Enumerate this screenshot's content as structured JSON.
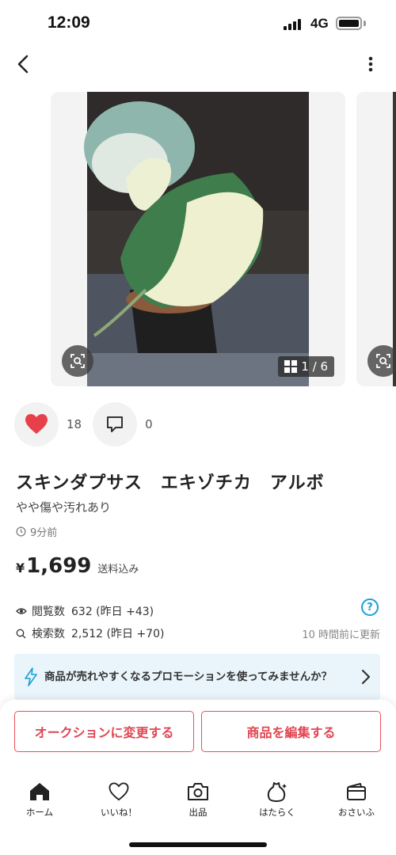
{
  "status_bar": {
    "time": "12:09",
    "network": "4G"
  },
  "carousel": {
    "counter": "1 / 6"
  },
  "engagement": {
    "likes": "18",
    "comments": "0"
  },
  "item": {
    "title": "スキンダプサス　エキゾチカ　アルボ",
    "condition": "やや傷や汚れあり",
    "posted": "9分前",
    "price_symbol": "¥",
    "price": "1,699",
    "shipping": "送料込み"
  },
  "stats": {
    "views_label": "閲覧数",
    "views_value": "632 (昨日 +43)",
    "search_label": "検索数",
    "search_value": "2,512 (昨日 +70)",
    "help": "?",
    "updated": "10 時間前に更新"
  },
  "promo": {
    "text": "商品が売れやすくなるプロモーションを使ってみませんか？"
  },
  "buttons": {
    "auction": "オークションに変更する",
    "edit": "商品を編集する"
  },
  "tabs": [
    {
      "label": "ホーム"
    },
    {
      "label": "いいね！"
    },
    {
      "label": "出品"
    },
    {
      "label": "はたらく"
    },
    {
      "label": "おさいふ"
    }
  ],
  "colors": {
    "accent_red": "#e8505b",
    "like_red": "#e8404a",
    "info_blue": "#1a9fd6"
  }
}
